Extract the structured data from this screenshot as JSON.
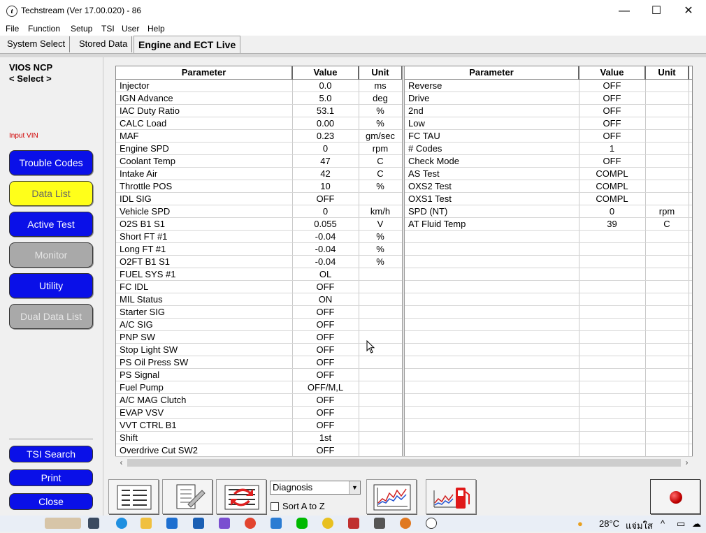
{
  "window": {
    "title": "Techstream (Ver 17.00.020) - 86",
    "minimize": "—",
    "maximize": "☐",
    "close": "✕"
  },
  "menu": [
    "File",
    "Function",
    "Setup",
    "TSI",
    "User",
    "Help"
  ],
  "tabs": [
    "System Select",
    "Stored Data",
    "Engine and ECT Live"
  ],
  "sidebar": {
    "vehicle": "VIOS NCP",
    "select": "< Select >",
    "input_vin": "Input VIN",
    "buttons": [
      "Trouble Codes",
      "Data List",
      "Active Test",
      "Monitor",
      "Utility",
      "Dual Data List"
    ],
    "bottom_buttons": [
      "TSI Search",
      "Print",
      "Close"
    ]
  },
  "table": {
    "headers": [
      "Parameter",
      "Value",
      "Unit"
    ],
    "left_rows": [
      [
        "Injector",
        "0.0",
        "ms"
      ],
      [
        "IGN Advance",
        "5.0",
        "deg"
      ],
      [
        "IAC Duty Ratio",
        "53.1",
        "%"
      ],
      [
        "CALC Load",
        "0.00",
        "%"
      ],
      [
        "MAF",
        "0.23",
        "gm/sec"
      ],
      [
        "Engine SPD",
        "0",
        "rpm"
      ],
      [
        "Coolant Temp",
        "47",
        "C"
      ],
      [
        "Intake Air",
        "42",
        "C"
      ],
      [
        "Throttle POS",
        "10",
        "%"
      ],
      [
        "IDL SIG",
        "OFF",
        ""
      ],
      [
        "Vehicle SPD",
        "0",
        "km/h"
      ],
      [
        "O2S B1 S1",
        "0.055",
        "V"
      ],
      [
        "Short FT #1",
        "-0.04",
        "%"
      ],
      [
        "Long FT #1",
        "-0.04",
        "%"
      ],
      [
        "O2FT B1 S1",
        "-0.04",
        "%"
      ],
      [
        "FUEL SYS #1",
        "OL",
        ""
      ],
      [
        "FC IDL",
        "OFF",
        ""
      ],
      [
        "MIL Status",
        "ON",
        ""
      ],
      [
        "Starter SIG",
        "OFF",
        ""
      ],
      [
        "A/C SIG",
        "OFF",
        ""
      ],
      [
        "PNP SW",
        "OFF",
        ""
      ],
      [
        "Stop Light SW",
        "OFF",
        ""
      ],
      [
        "PS Oil Press SW",
        "OFF",
        ""
      ],
      [
        "PS Signal",
        "OFF",
        ""
      ],
      [
        "Fuel Pump",
        "OFF/M,L",
        ""
      ],
      [
        "A/C MAG Clutch",
        "OFF",
        ""
      ],
      [
        "EVAP VSV",
        "OFF",
        ""
      ],
      [
        "VVT CTRL B1",
        "OFF",
        ""
      ],
      [
        "Shift",
        "1st",
        ""
      ],
      [
        "Overdrive Cut SW2",
        "OFF",
        ""
      ]
    ],
    "right_rows": [
      [
        "Reverse",
        "OFF",
        ""
      ],
      [
        "Drive",
        "OFF",
        ""
      ],
      [
        "2nd",
        "OFF",
        ""
      ],
      [
        "Low",
        "OFF",
        ""
      ],
      [
        "FC TAU",
        "OFF",
        ""
      ],
      [
        "# Codes",
        "1",
        ""
      ],
      [
        "Check Mode",
        "OFF",
        ""
      ],
      [
        "AS Test",
        "COMPL",
        ""
      ],
      [
        "OXS2 Test",
        "COMPL",
        ""
      ],
      [
        "OXS1 Test",
        "COMPL",
        ""
      ],
      [
        "SPD (NT)",
        "0",
        "rpm"
      ],
      [
        "AT Fluid Temp",
        "39",
        "C"
      ]
    ]
  },
  "toolbar": {
    "combo_value": "Diagnosis",
    "sort_label": "Sort A to Z"
  },
  "taskbar": {
    "weather": "28°C",
    "weather_text": "แจ่มใส"
  },
  "colors": {
    "blue_button": "#0a10e8",
    "yellow_button": "#ffff1a",
    "gray_button": "#a9a9a9",
    "input_vin": "#d00000"
  }
}
